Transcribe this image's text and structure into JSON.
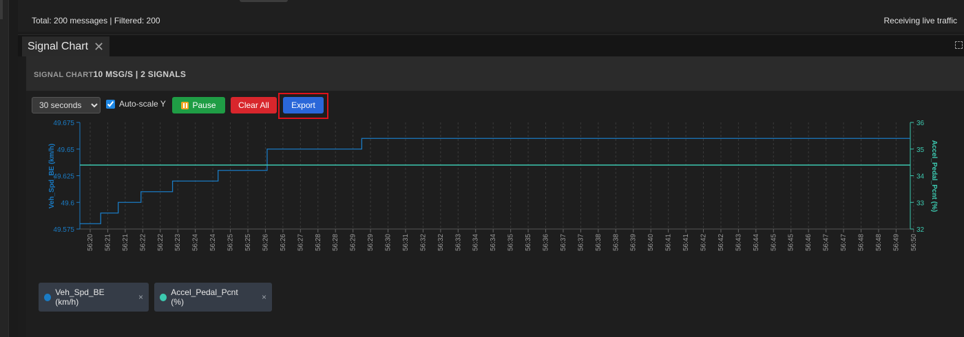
{
  "status": {
    "left": "Total: 200 messages | Filtered: 200",
    "right": "Receiving live traffic"
  },
  "tab": {
    "title": "Signal Chart",
    "close": "✕"
  },
  "header": {
    "title": "SIGNAL CHART",
    "subtitle": "10 MSG/S | 2 SIGNALS"
  },
  "toolbar": {
    "range_options": [
      "30 seconds"
    ],
    "range_selected": "30 seconds",
    "autoscale_label": "Auto-scale Y",
    "autoscale_checked": true,
    "pause_label": "Pause",
    "clear_label": "Clear All",
    "export_label": "Export"
  },
  "colors": {
    "series1": "#1a7bc4",
    "series2": "#3cc9b0",
    "pause": "#1f9d45",
    "clear": "#d8262c",
    "export": "#2a67d9"
  },
  "chart_data": {
    "type": "line",
    "ylabel": "Veh_Spd_BE (km/h)",
    "y2label": "Accel_Pedal_Pcnt (%)",
    "ylim": [
      49.575,
      49.675
    ],
    "y2lim": [
      32,
      36
    ],
    "yticks": [
      "49.575",
      "49.6",
      "49.625",
      "49.65",
      "49.675"
    ],
    "y2ticks": [
      "32",
      "33",
      "34",
      "35",
      "36"
    ],
    "xticks": [
      "56:20",
      "56:21",
      "56:21",
      "56:22",
      "56:22",
      "56:23",
      "56:24",
      "56:24",
      "56:25",
      "56:25",
      "56:26",
      "56:26",
      "56:27",
      "56:28",
      "56:28",
      "56:29",
      "56:29",
      "56:30",
      "56:31",
      "56:32",
      "56:32",
      "56:33",
      "56:34",
      "56:34",
      "56:35",
      "56:35",
      "56:36",
      "56:37",
      "56:37",
      "56:38",
      "56:38",
      "56:39",
      "56:40",
      "56:41",
      "56:41",
      "56:42",
      "56:42",
      "56:43",
      "56:44",
      "56:45",
      "56:45",
      "56:46",
      "56:47",
      "56:47",
      "56:48",
      "56:48",
      "56:49",
      "56:50"
    ],
    "grid": true,
    "series": [
      {
        "name": "Veh_Spd_BE (km/h)",
        "axis": "left",
        "step": true,
        "x": [
          0,
          0.6,
          1.6,
          2.9,
          4.7,
          7.3,
          10.1,
          15.5,
          53.5
        ],
        "y": [
          49.58,
          49.59,
          49.6,
          49.61,
          49.62,
          49.63,
          49.65,
          49.66,
          49.66
        ]
      },
      {
        "name": "Accel_Pedal_Pcnt (%)",
        "axis": "right",
        "step": true,
        "x": [
          0,
          53.5
        ],
        "y": [
          34.4,
          34.4
        ]
      }
    ]
  },
  "legend": [
    {
      "label": "Veh_Spd_BE (km/h)",
      "remove": "×"
    },
    {
      "label": "Accel_Pedal_Pcnt (%)",
      "remove": "×"
    }
  ]
}
